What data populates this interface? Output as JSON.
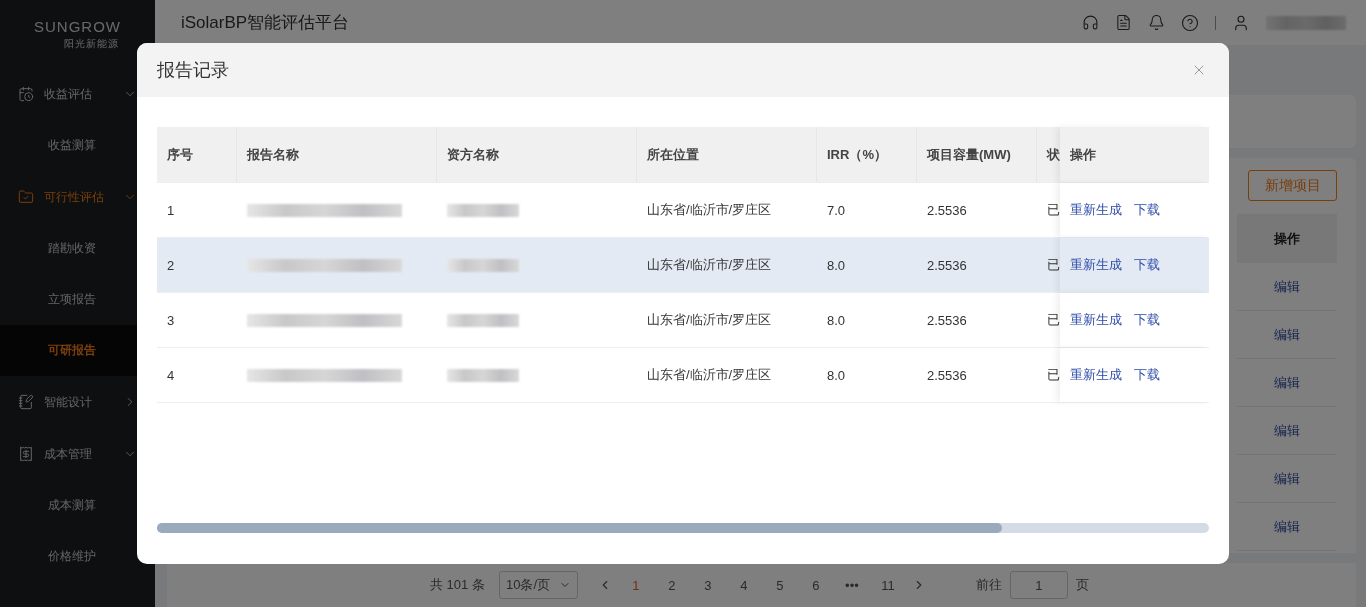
{
  "header": {
    "title": "iSolarBP智能评估平台"
  },
  "sidebar": {
    "logo": {
      "brand": "SUNGROW",
      "tagline": "阳光新能源"
    },
    "items": [
      {
        "label": "收益评估",
        "kind": "revenue",
        "expanded": true,
        "selected": false,
        "children": [
          {
            "label": "收益测算",
            "selected": false
          }
        ]
      },
      {
        "label": "可行性评估",
        "kind": "feasibility",
        "expanded": true,
        "selected": true,
        "children": [
          {
            "label": "踏勘收资",
            "selected": false
          },
          {
            "label": "立项报告",
            "selected": false
          },
          {
            "label": "可研报告",
            "selected": true
          }
        ]
      },
      {
        "label": "智能设计",
        "kind": "design",
        "expanded": false,
        "selected": false
      },
      {
        "label": "成本管理",
        "kind": "cost",
        "expanded": true,
        "selected": false,
        "children": [
          {
            "label": "成本测算",
            "selected": false
          },
          {
            "label": "价格维护",
            "selected": false
          }
        ]
      }
    ]
  },
  "page": {
    "add_button": "新增项目",
    "action_column": "操作",
    "row_actions": [
      "编辑",
      "编辑",
      "编辑",
      "编辑",
      "编辑",
      "编辑"
    ],
    "pagination": {
      "total": "共 101 条",
      "page_size": "10条/页",
      "pages": [
        {
          "label": "1",
          "selected": true
        },
        {
          "label": "2",
          "selected": false
        },
        {
          "label": "3",
          "selected": false
        },
        {
          "label": "4",
          "selected": false
        },
        {
          "label": "5",
          "selected": false
        },
        {
          "label": "6",
          "selected": false
        },
        {
          "label": "•••",
          "selected": false
        },
        {
          "label": "11",
          "selected": false
        }
      ],
      "jump_label": "前往",
      "jump_value": "1",
      "jump_unit": "页"
    }
  },
  "modal": {
    "title": "报告记录",
    "columns": [
      "序号",
      "报告名称",
      "资方名称",
      "所在位置",
      "IRR（%）",
      "项目容量(MW)",
      "状",
      "操作"
    ],
    "rows": [
      {
        "index": "1",
        "location": "山东省/临沂市/罗庄区",
        "irr": "7.0",
        "capacity": "2.5536",
        "status": "已",
        "hovered": false,
        "actions": [
          "重新生成",
          "下载"
        ]
      },
      {
        "index": "2",
        "location": "山东省/临沂市/罗庄区",
        "irr": "8.0",
        "capacity": "2.5536",
        "status": "已",
        "hovered": true,
        "actions": [
          "重新生成",
          "下载"
        ]
      },
      {
        "index": "3",
        "location": "山东省/临沂市/罗庄区",
        "irr": "8.0",
        "capacity": "2.5536",
        "status": "已",
        "hovered": false,
        "actions": [
          "重新生成",
          "下载"
        ]
      },
      {
        "index": "4",
        "location": "山东省/临沂市/罗庄区",
        "irr": "8.0",
        "capacity": "2.5536",
        "status": "已",
        "hovered": false,
        "actions": [
          "重新生成",
          "下载"
        ]
      }
    ]
  }
}
